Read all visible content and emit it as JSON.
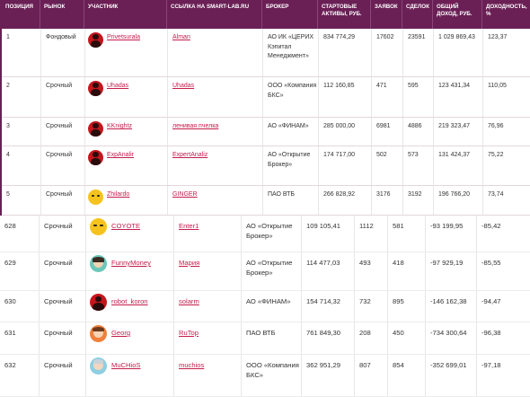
{
  "header": {
    "position": "ПОЗИЦИЯ",
    "market": "РЫНОК",
    "participant": "УЧАСТНИК",
    "link": "ССЫЛКА НА SMART-LAB.RU",
    "broker": "БРОКЕР",
    "start_assets": "СТАРТОВЫЕ АКТИВЫ, РУБ.",
    "orders": "ЗАЯВОК",
    "deals": "СДЕЛОК",
    "total_income": "ОБЩИЙ ДОХОД, РУБ.",
    "yield": "ДОХОДНОСТЬ, %"
  },
  "top_rows": [
    {
      "pos": "1",
      "market": "Фондовый",
      "user": "Privetsurala",
      "avatar": "red",
      "link": "Alman",
      "broker": "АО ИК «ЦЕРИХ Кэпитал Менеджмент»",
      "assets": "834 774,29",
      "orders": "17602",
      "deals": "23591",
      "income": "1 029 869,43",
      "yield": "123,37"
    },
    {
      "pos": "2",
      "market": "Срочный",
      "user": "Uhadas",
      "avatar": "red",
      "link": "Uhadas",
      "broker": "ООО «Компания БКС»",
      "assets": "112 160,85",
      "orders": "471",
      "deals": "595",
      "income": "123 431,34",
      "yield": "110,05"
    },
    {
      "pos": "3",
      "market": "Срочный",
      "user": "KKnightz",
      "avatar": "red",
      "link": "ленивая пчелка",
      "broker": "АО «ФИНАМ»",
      "assets": "285 000,00",
      "orders": "6981",
      "deals": "4886",
      "income": "219 323,47",
      "yield": "76,96"
    },
    {
      "pos": "4",
      "market": "Срочный",
      "user": "ExpAnalir",
      "avatar": "red",
      "link": "ExpertAnaliz",
      "broker": "АО «Открытие Брокер»",
      "assets": "174 717,00",
      "orders": "502",
      "deals": "573",
      "income": "131 424,37",
      "yield": "75,22"
    },
    {
      "pos": "5",
      "market": "Срочный",
      "user": "Zhilardo",
      "avatar": "yellow",
      "link": "GINGER",
      "broker": "ПАО ВТБ",
      "assets": "266 828,92",
      "orders": "3176",
      "deals": "3192",
      "income": "196 766,20",
      "yield": "73,74"
    }
  ],
  "bottom_rows": [
    {
      "pos": "628",
      "market": "Срочный",
      "user": "COYOTE",
      "avatar": "yellow",
      "link": "Enter1",
      "broker": "АО «Открытие Брокер»",
      "assets": "109 105,41",
      "orders": "1112",
      "deals": "581",
      "income": "-93 199,95",
      "yield": "-85,42"
    },
    {
      "pos": "629",
      "market": "Срочный",
      "user": "FunnyMoney",
      "avatar": "green",
      "link": "Мария",
      "broker": "АО «Открытие Брокер»",
      "assets": "114 477,03",
      "orders": "493",
      "deals": "418",
      "income": "-97 929,19",
      "yield": "-85,55"
    },
    {
      "pos": "630",
      "market": "Срочный",
      "user": "robot_koron",
      "avatar": "red",
      "link": "solarm",
      "broker": "АО «ФИНАМ»",
      "assets": "154 714,32",
      "orders": "732",
      "deals": "895",
      "income": "-146 162,38",
      "yield": "-94,47"
    },
    {
      "pos": "631",
      "market": "Срочный",
      "user": "Georg",
      "avatar": "orange",
      "link": "RuTop",
      "broker": "ПАО ВТБ",
      "assets": "761 849,30",
      "orders": "208",
      "deals": "450",
      "income": "-734 300,64",
      "yield": "-96,38"
    },
    {
      "pos": "632",
      "market": "Срочный",
      "user": "MuCHioS",
      "avatar": "teal",
      "link": "muchios",
      "broker": "ООО «Компания БКС»",
      "assets": "362 951,29",
      "orders": "807",
      "deals": "854",
      "income": "-352 699,01",
      "yield": "-97,18"
    }
  ],
  "colors": {
    "header_bg": "#6a1f55",
    "link": "#c41d4d"
  }
}
